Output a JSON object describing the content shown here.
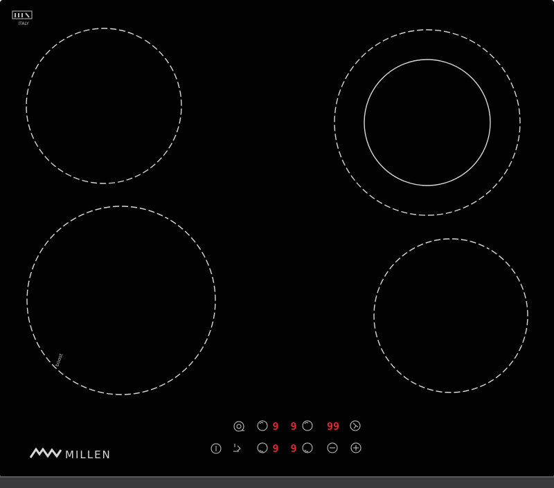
{
  "cooktop": {
    "glass_color": "#020203",
    "ring_color": "#d9d9d9",
    "display_color": "#e0262e",
    "control_color": "#cfcfcf",
    "badge": {
      "country_text": "ITALY"
    },
    "zones": [
      {
        "name": "zone-rear-left",
        "type": "single"
      },
      {
        "name": "zone-rear-right",
        "type": "dual"
      },
      {
        "name": "zone-front-left",
        "type": "single",
        "label": "boost"
      },
      {
        "name": "zone-front-right",
        "type": "single"
      }
    ],
    "controls": {
      "top_row": [
        {
          "kind": "icon",
          "icon": "power-icon"
        },
        {
          "kind": "icon",
          "icon": "zone-select-icon"
        },
        {
          "kind": "display",
          "value": "9"
        },
        {
          "kind": "display",
          "value": "9"
        },
        {
          "kind": "icon",
          "icon": "zone-select-icon"
        },
        {
          "kind": "display",
          "value": "99"
        },
        {
          "kind": "icon",
          "icon": "lock-icon"
        }
      ],
      "bottom_row": [
        {
          "kind": "icon",
          "icon": "info-icon"
        },
        {
          "kind": "icon",
          "icon": "timer-icon"
        },
        {
          "kind": "icon",
          "icon": "zone-select-icon"
        },
        {
          "kind": "display",
          "value": "9"
        },
        {
          "kind": "display",
          "value": "9"
        },
        {
          "kind": "icon",
          "icon": "zone-select-icon"
        },
        {
          "kind": "icon",
          "icon": "minus-icon"
        },
        {
          "kind": "icon",
          "icon": "plus-icon"
        }
      ]
    },
    "brand": {
      "name": "MILLEN"
    }
  }
}
